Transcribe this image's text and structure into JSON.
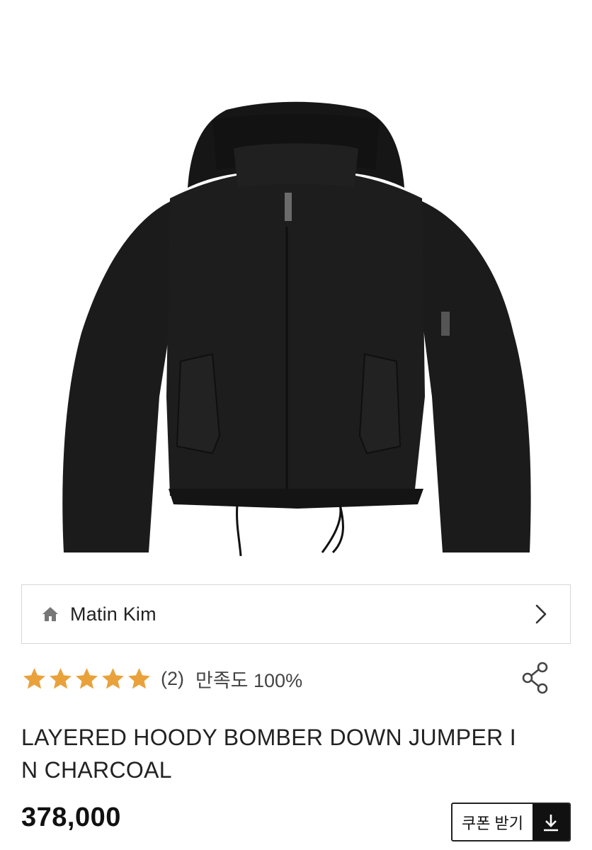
{
  "brand": {
    "name": "Matin Kim"
  },
  "rating": {
    "stars": 5,
    "max_stars": 5,
    "review_count": "(2)",
    "satisfaction": "만족도 100%"
  },
  "product": {
    "title": "LAYERED HOODY BOMBER DOWN JUMPER IN CHARCOAL",
    "price": "378,000"
  },
  "coupon": {
    "label": "쿠폰 받기"
  },
  "colors": {
    "star": "#E9A23B",
    "garment": "#1a1a1a",
    "border": "#d8d8d8"
  },
  "icons": {
    "home": "home-icon",
    "chevron": "chevron-right-icon",
    "share": "share-icon",
    "download": "download-icon"
  }
}
